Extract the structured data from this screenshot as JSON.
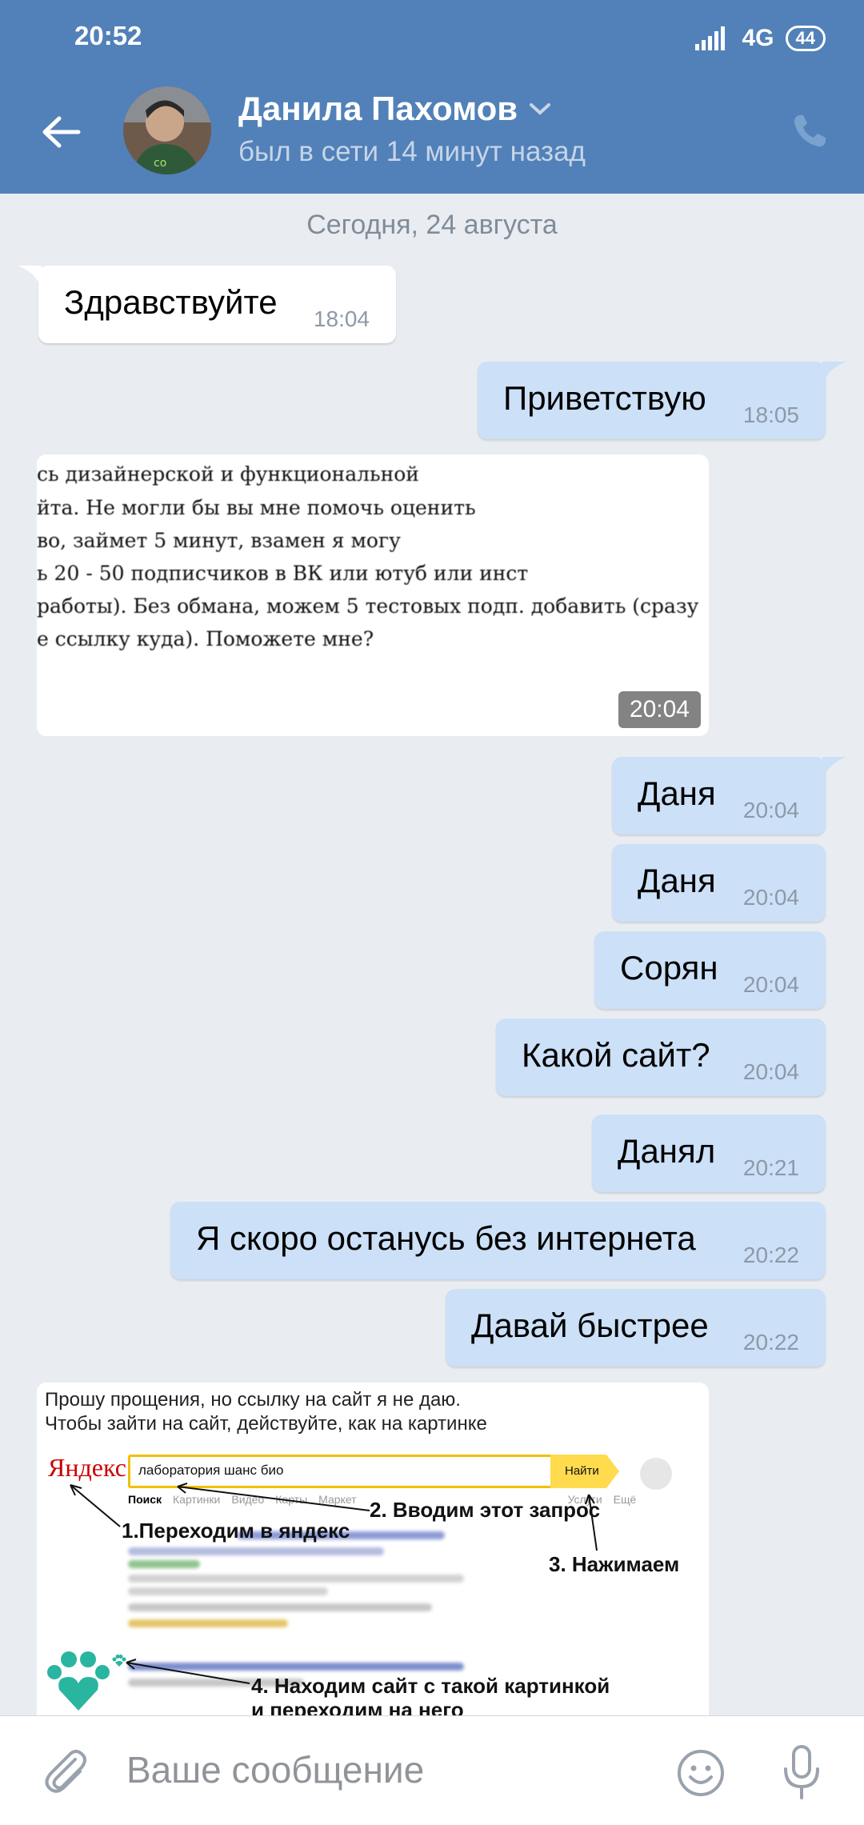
{
  "status_bar": {
    "time": "20:52",
    "network": "4G",
    "battery": "44"
  },
  "header": {
    "name": "Данила Пахомов",
    "status": "был в сети 14 минут назад"
  },
  "date_separator": "Сегодня, 24 августа",
  "messages": [
    {
      "dir": "in",
      "text": "Здравствуйте",
      "time": "18:04"
    },
    {
      "dir": "out",
      "text": "Приветствую",
      "time": "18:05"
    },
    {
      "dir": "in",
      "type": "image",
      "time": "20:04",
      "lines": [
        "сь дизайнерской и функциональной",
        "йта. Не могли бы вы мне помочь оценить",
        "во, займет 5 минут, взамен я могу",
        "ь 20 - 50 подписчиков в ВК или ютуб или инст",
        "работы). Без обмана, можем 5 тестовых подп. добавить (сразу",
        "е ссылку куда). Поможете мне?"
      ]
    },
    {
      "dir": "out",
      "text": "Даня",
      "time": "20:04"
    },
    {
      "dir": "out",
      "text": "Даня",
      "time": "20:04"
    },
    {
      "dir": "out",
      "text": "Сорян",
      "time": "20:04"
    },
    {
      "dir": "out",
      "text": "Какой сайт?",
      "time": "20:04"
    },
    {
      "dir": "out",
      "text": "Данял",
      "time": "20:21"
    },
    {
      "dir": "out",
      "text": "Я скоро останусь без интернета",
      "time": "20:22"
    },
    {
      "dir": "out",
      "text": "Давай быстрее",
      "time": "20:22"
    }
  ],
  "yandex_image": {
    "caption_1": "Прошу прощения, но ссылку на сайт я не даю.",
    "caption_2": "Чтобы зайти на сайт, действуйте, как на картинке",
    "logo": "Яндекс",
    "query": "лаборатория шанс био",
    "button": "Найти",
    "tabs": [
      "Поиск",
      "Картинки",
      "Видео",
      "Карты",
      "Маркет",
      "Услуги",
      "Ещё"
    ],
    "steps": [
      "1.Переходим в яндекс",
      "2. Вводим этот запрос",
      "3. Нажимаем",
      "4. Находим сайт с такой картинкой",
      "и переходим на него"
    ]
  },
  "composer": {
    "placeholder": "Ваше сообщение"
  },
  "colors": {
    "header": "#5181b8",
    "outgoing": "#cce0f7",
    "incoming": "#ffffff",
    "background": "#e9edf2"
  }
}
